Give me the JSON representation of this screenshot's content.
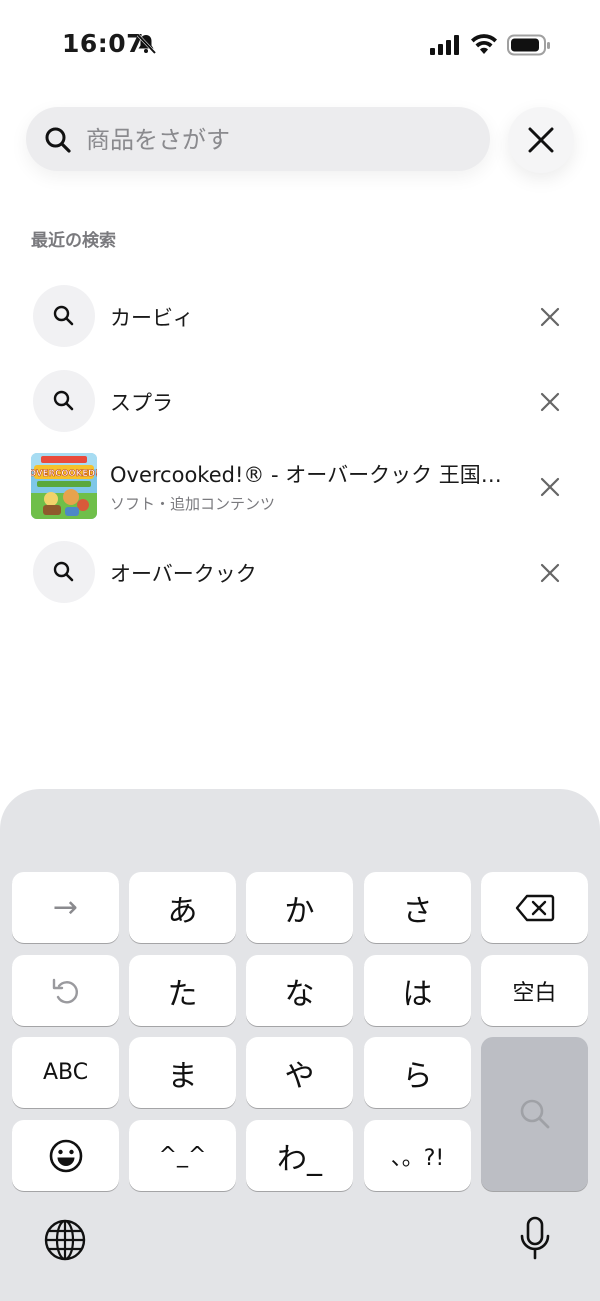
{
  "status_bar": {
    "time": "16:07"
  },
  "search": {
    "placeholder": "商品をさがす"
  },
  "recent": {
    "title": "最近の検索",
    "items": [
      {
        "type": "query",
        "label": "カービィ"
      },
      {
        "type": "query",
        "label": "スプラ"
      },
      {
        "type": "product",
        "label": "Overcooked!® - オーバークック 王国…",
        "sublabel": "ソフト・追加コンテンツ",
        "thumbnail_text": "OVERCOOKED!"
      },
      {
        "type": "query",
        "label": "オーバークック"
      }
    ]
  },
  "keyboard": {
    "rows": [
      [
        "→",
        "あ",
        "か",
        "さ",
        "delete"
      ],
      [
        "undo",
        "た",
        "な",
        "は",
        "空白"
      ],
      [
        "ABC",
        "ま",
        "や",
        "ら",
        "search"
      ],
      [
        "emoji",
        "^_^",
        "わ_",
        "、。?!"
      ]
    ],
    "keys": {
      "arrow": "→",
      "a": "あ",
      "ka": "か",
      "sa": "さ",
      "ta": "た",
      "na": "な",
      "ha": "は",
      "space": "空白",
      "abc": "ABC",
      "ma": "ま",
      "ya": "や",
      "ra": "ら",
      "kaomoji": "^_^",
      "wa": "わ_",
      "punct": "、。?!"
    }
  },
  "colors": {
    "search_bg": "#ececee",
    "keyboard_bg": "#e3e4e7",
    "return_key": "#bcbec4",
    "muted_text": "#7a7a7e"
  }
}
